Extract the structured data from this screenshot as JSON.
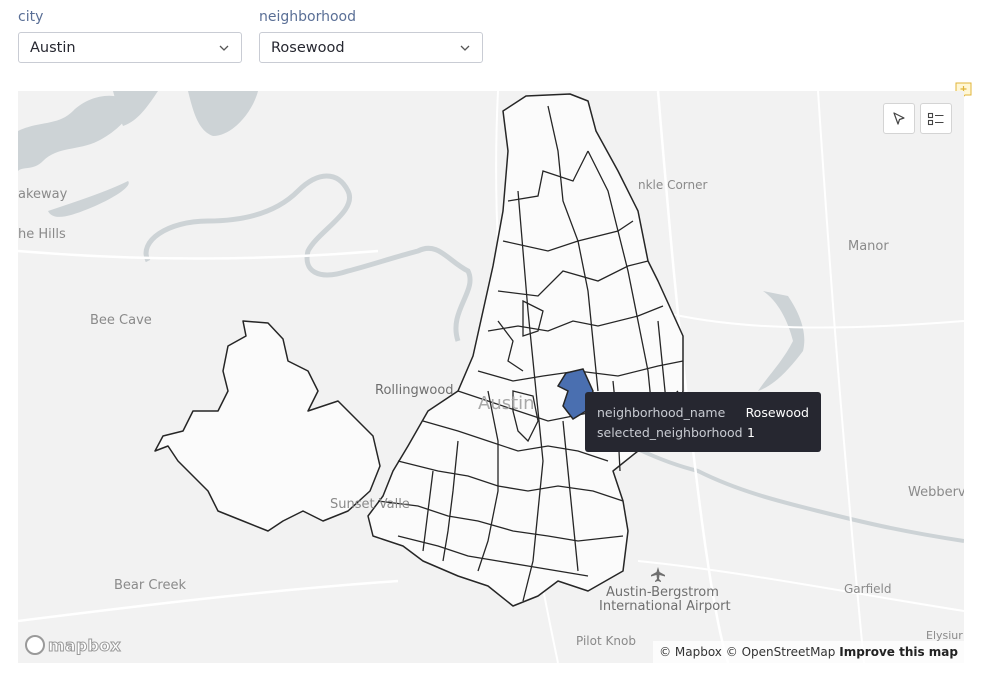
{
  "filters": {
    "city": {
      "label": "city",
      "value": "Austin"
    },
    "neighborhood": {
      "label": "neighborhood",
      "value": "Rosewood"
    }
  },
  "map": {
    "place_labels": {
      "lakeway": "akeway",
      "the_hills": "he Hills",
      "bee_cave": "Bee Cave",
      "rollingwood": "Rollingwood",
      "austin": "Austin",
      "sunset_valley": "Sunset Valle",
      "bear_creek": "Bear Creek",
      "sprinkle_corner": "nkle Corner",
      "manor": "Manor",
      "webberville": "Webberv",
      "airport_line1": "Austin-Bergstrom",
      "airport_line2": "International Airport",
      "garfield": "Garfield",
      "pilot_knob": "Pilot Knob",
      "elysium": "Elysiur"
    },
    "tooltip": {
      "rows": [
        {
          "key": "neighborhood_name",
          "value": "Rosewood"
        },
        {
          "key": "selected_neighborhood",
          "value": "1"
        }
      ]
    },
    "attribution": {
      "mapbox": "© Mapbox",
      "osm": "© OpenStreetMap",
      "improve": "Improve this map"
    },
    "logo_text": "mapbox",
    "controls": {
      "select_tool_icon": "cursor-arrow-icon",
      "legend_icon": "list-icon"
    },
    "colors": {
      "selected_fill": "#4a6fb0",
      "polygon_fill": "#fbfbfb",
      "polygon_stroke": "#262626",
      "water": "#cdd3d6",
      "tooltip_bg": "#262730"
    }
  }
}
